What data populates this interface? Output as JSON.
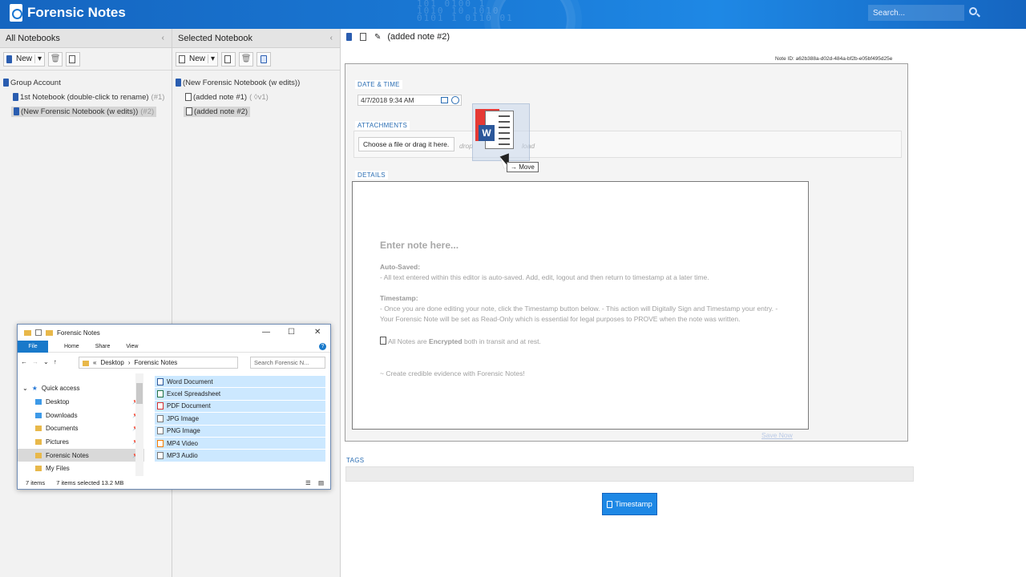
{
  "app": {
    "title": "Forensic Notes",
    "search_placeholder": "Search..."
  },
  "left": {
    "header": "All Notebooks",
    "new_label": "New",
    "items": [
      {
        "label": "Group Account",
        "suffix": ""
      },
      {
        "label": "1st Notebook (double-click to rename)",
        "suffix": "(#1)"
      },
      {
        "label": "(New Forensic Notebook (w edits))",
        "suffix": "(#2)"
      }
    ]
  },
  "middle": {
    "header": "Selected Notebook",
    "new_label": "New",
    "items": [
      {
        "label": "(New Forensic Notebook (w edits))",
        "suffix": ""
      },
      {
        "label": "(added note #1)",
        "suffix": "( ◊v1)"
      },
      {
        "label": "(added note #2)",
        "suffix": ""
      }
    ]
  },
  "note": {
    "title": "(added note #2)",
    "note_id": "Note ID: a62b388a-d02d-484a-bf2b-e05bf495d25e",
    "date_time_label": "Date & Time",
    "date_value": "4/7/2018 9:34 AM",
    "attachments_label": "Attachments",
    "choose_file": "Choose a file or drag it here.",
    "drop_text": "drop",
    "drop_text2": "load",
    "move_tooltip": "→ Move",
    "details_label": "Details",
    "placeholder_heading": "Enter note here...",
    "autosaved_title": "Auto-Saved:",
    "autosaved_text": "- All text entered within this editor is auto-saved. Add, edit, logout and then return to timestamp at a later time.",
    "timestamp_title": "Timestamp:",
    "timestamp_text": "- Once you are done editing your note, click the Timestamp button below. - This action will Digitally Sign and Timestamp your entry. - Your Forensic Note will be set as Read-Only which is essential for legal purposes to PROVE when the note was written.",
    "encrypted_pre": "All Notes are ",
    "encrypted_bold": "Encrypted",
    "encrypted_post": " both in transit and at rest.",
    "tagline": "~ Create credible evidence with Forensic Notes!",
    "save_now": "Save Now",
    "tags_label": "Tags",
    "timestamp_button": "Timestamp"
  },
  "explorer": {
    "title": "Forensic Notes",
    "tabs": [
      "File",
      "Home",
      "Share",
      "View"
    ],
    "path": [
      "«",
      "Desktop",
      "›",
      "Forensic Notes"
    ],
    "search_placeholder": "Search Forensic N...",
    "nav": [
      {
        "label": "Quick access"
      },
      {
        "label": "Desktop"
      },
      {
        "label": "Downloads"
      },
      {
        "label": "Documents"
      },
      {
        "label": "Pictures"
      },
      {
        "label": "Forensic Notes"
      },
      {
        "label": "My Files"
      }
    ],
    "files": [
      "Word Document",
      "Excel Spreadsheet",
      "PDF Document",
      "JPG Image",
      "PNG Image",
      "MP4 Video",
      "MP3 Audio"
    ],
    "status_items": "7 items",
    "status_selected": "7 items selected  13.2 MB"
  },
  "colors": {
    "accent": "#1e88e5",
    "header_blue": "#1976d2",
    "section_blue": "#2a6db3"
  }
}
